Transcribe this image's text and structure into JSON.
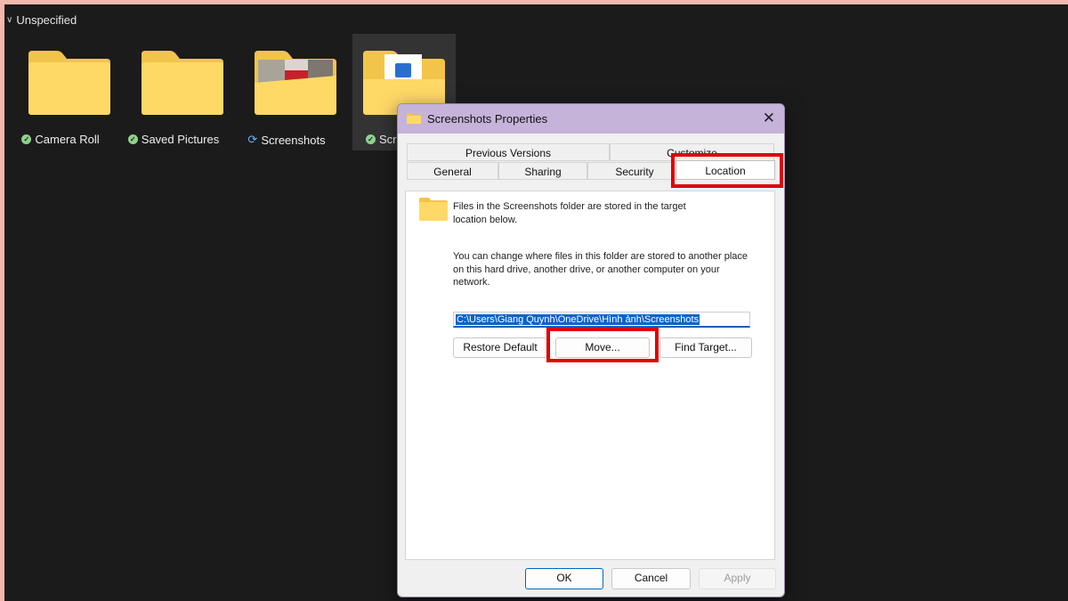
{
  "explorer": {
    "group_label": "Unspecified",
    "items": [
      {
        "label": "Camera Roll",
        "status": "synced-check"
      },
      {
        "label": "Saved Pictures",
        "status": "synced-check"
      },
      {
        "label": "Screenshots",
        "status": "syncing"
      },
      {
        "label": "Scr",
        "status": "synced-check"
      }
    ]
  },
  "dialog": {
    "title": "Screenshots Properties",
    "tabs_row1": [
      "Previous Versions",
      "Customize"
    ],
    "tabs_row2": [
      "General",
      "Sharing",
      "Security",
      "Location"
    ],
    "active_tab": "Location",
    "info_text": "Files in the Screenshots folder are stored in the target location below.",
    "change_text": "You can change where files in this folder are stored to another place on this hard drive, another drive, or another computer on your network.",
    "path_value": "C:\\Users\\Giang Quynh\\OneDrive\\Hình ảnh\\Screenshots",
    "buttons": {
      "restore_default": "Restore Default",
      "move": "Move...",
      "find_target": "Find Target...",
      "ok": "OK",
      "cancel": "Cancel",
      "apply": "Apply"
    }
  },
  "colors": {
    "highlight": "#e00000",
    "titlebar": "#c5b3d9",
    "accent": "#0067c0",
    "page_border": "#f2b8ad"
  }
}
